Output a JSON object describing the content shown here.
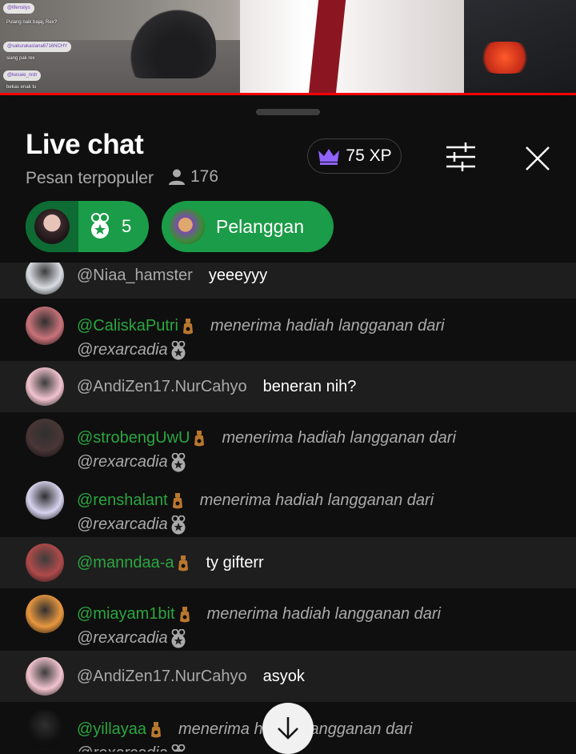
{
  "video": {
    "mini_chat": [
      {
        "user": "@llfensilys",
        "text": "Pulang naik bajaj, Rex?"
      },
      {
        "user": "@sakurakaslana6716NCHY",
        "text": "siang pak rex"
      },
      {
        "user": "@kesaie_nrdr",
        "text": "bekas enak tu"
      }
    ]
  },
  "header": {
    "title": "Live chat",
    "mode": "Pesan terpopuler",
    "viewer_count": "176",
    "xp_label": "75 XP"
  },
  "chips": {
    "gift_count": "5",
    "subscribers_label": "Pelanggan"
  },
  "messages": [
    {
      "author": "@Niaa_hamster",
      "member": false,
      "type": "text",
      "text": "yeeeyyy",
      "avatar_color": "#d9dde3"
    },
    {
      "author": "@CaliskaPutri",
      "member": true,
      "type": "gift",
      "text": "menerima hadiah langganan dari",
      "from": "@rexarcadia",
      "avatar_color": "#c9737a"
    },
    {
      "author": "@AndiZen17.NurCahyo",
      "member": false,
      "type": "text",
      "text": "beneran nih?",
      "avatar_color": "#f2c3cf"
    },
    {
      "author": "@strobengUwU",
      "member": true,
      "type": "gift",
      "text": "menerima hadiah langganan dari",
      "from": "@rexarcadia",
      "avatar_color": "#4a3636"
    },
    {
      "author": "@renshalant",
      "member": true,
      "type": "gift",
      "text": "menerima hadiah langganan dari",
      "from": "@rexarcadia",
      "avatar_color": "#d8d3ef"
    },
    {
      "author": "@manndaa-a",
      "member": true,
      "type": "text",
      "text": "ty gifterr",
      "avatar_color": "#b04a4a"
    },
    {
      "author": "@miayam1bit",
      "member": true,
      "type": "gift",
      "text": "menerima hadiah langganan dari",
      "from": "@rexarcadia",
      "avatar_color": "#e8973f"
    },
    {
      "author": "@AndiZen17.NurCahyo",
      "member": false,
      "type": "text",
      "text": "asyok",
      "avatar_color": "#f2c3cf"
    },
    {
      "author": "@yillayaa",
      "member": true,
      "type": "gift",
      "text": "menerima hadiah langganan dari",
      "from": "@rexarcadia",
      "avatar_color": "#111111"
    }
  ],
  "colors": {
    "member_name": "#2ba640",
    "chip_green": "#1b9c48",
    "xp_crown": "#8f63ff",
    "background": "#0f0f0f"
  },
  "icons": {
    "xp": "crown-icon",
    "filter": "sliders-icon",
    "close": "close-icon",
    "viewers": "person-icon",
    "gift": "gift-ribbon-icon",
    "scroll": "arrow-down-icon"
  }
}
